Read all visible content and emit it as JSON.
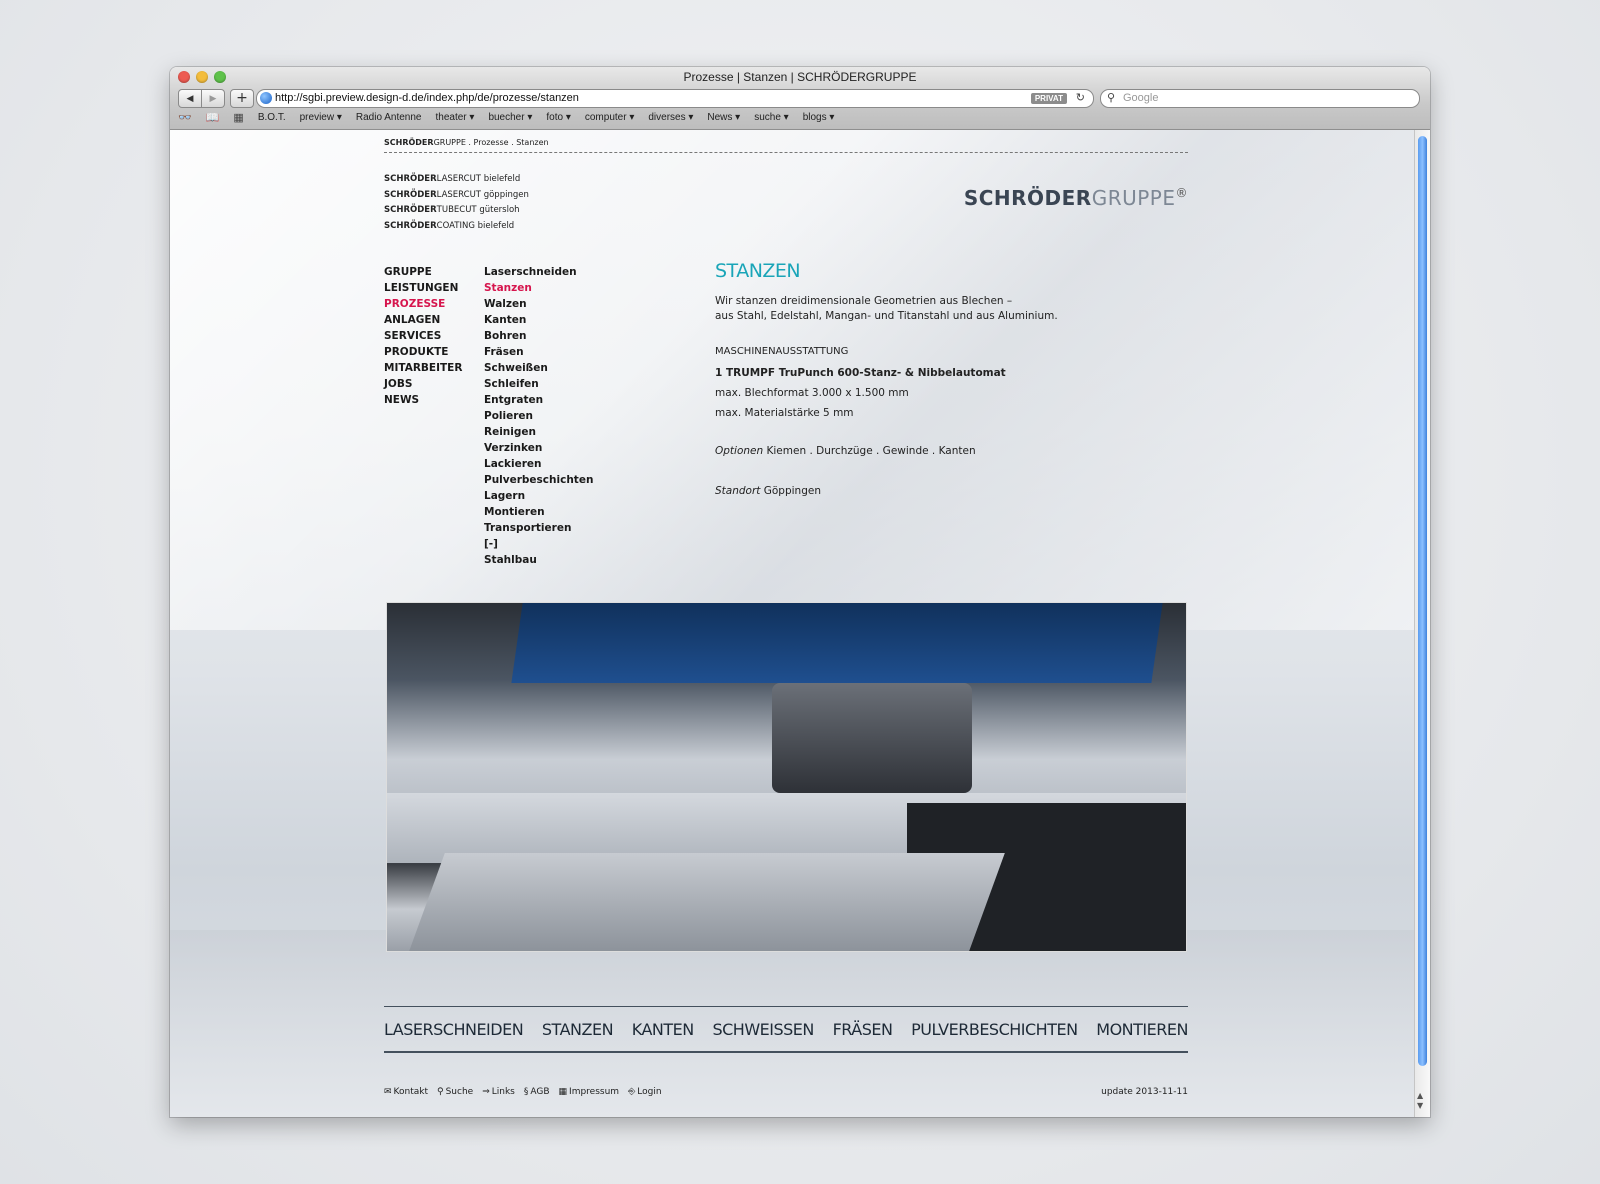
{
  "window": {
    "title": "Prozesse | Stanzen | SCHRÖDERGRUPPE"
  },
  "toolbar": {
    "url": "http://sgbi.preview.design-d.de/index.php/de/prozesse/stanzen",
    "privat_label": "PRIVAT",
    "search_placeholder": "Google",
    "bookmarks": [
      "B.O.T.",
      "preview ▾",
      "Radio Antenne",
      "theater ▾",
      "buecher ▾",
      "foto ▾",
      "computer ▾",
      "diverses ▾",
      "News ▾",
      "suche ▾",
      "blogs ▾"
    ]
  },
  "page": {
    "breadcrumb": {
      "brand_bold": "SCHRÖDER",
      "brand_rest": "GRUPPE",
      "path": " . Prozesse . Stanzen"
    },
    "sites": [
      {
        "bold": "SCHRÖDER",
        "sub": "LASERCUT",
        "city": " bielefeld"
      },
      {
        "bold": "SCHRÖDER",
        "sub": "LASERCUT",
        "city": " göppingen"
      },
      {
        "bold": "SCHRÖDER",
        "sub": "TUBECUT",
        "city": " gütersloh"
      },
      {
        "bold": "SCHRÖDER",
        "sub": "COATING",
        "city": " bielefeld"
      }
    ],
    "logo": {
      "part1": "SCHRÖDER",
      "part2": "GRUPPE",
      "reg": "®"
    },
    "nav_main": [
      "GRUPPE",
      "LEISTUNGEN",
      "PROZESSE",
      "ANLAGEN",
      "SERVICES",
      "PRODUKTE",
      "MITARBEITER",
      "JOBS",
      "NEWS"
    ],
    "nav_main_active": "PROZESSE",
    "nav_sub": [
      "Laserschneiden",
      "Stanzen",
      "Walzen",
      "Kanten",
      "Bohren",
      "Fräsen",
      "Schweißen",
      "Schleifen",
      "Entgraten",
      "Polieren",
      "Reinigen",
      "Verzinken",
      "Lackieren",
      "Pulverbeschichten",
      "Lagern",
      "Montieren",
      "Transportieren",
      "[-]",
      "Stahlbau"
    ],
    "nav_sub_active": "Stanzen",
    "main": {
      "heading": "STANZEN",
      "intro_line1": "Wir stanzen dreidimensionale Geometrien aus Blechen –",
      "intro_line2": "aus Stahl, Edelstahl, Mangan- und Titanstahl und aus Aluminium.",
      "equip_heading": "MASCHINENAUSSTATTUNG",
      "equip_machine": "1 TRUMPF TruPunch 600-Stanz- & Nibbelautomat",
      "equip_format": "max. Blechformat 3.000 x 1.500 mm",
      "equip_thickness": "max. Materialstärke 5 mm",
      "options_label": "Optionen",
      "options_value": " Kiemen . Durchzüge . Gewinde . Kanten",
      "location_label": "Standort",
      "location_value": " Göppingen"
    },
    "process_tabs": [
      "LASERSCHNEIDEN",
      "STANZEN",
      "KANTEN",
      "SCHWEISSEN",
      "FRÄSEN",
      "PULVERBESCHICHTEN",
      "MONTIEREN"
    ],
    "footer": {
      "links": [
        {
          "icon": "✉",
          "label": "Kontakt"
        },
        {
          "icon": "⚲",
          "label": "Suche"
        },
        {
          "icon": "⇒",
          "label": "Links"
        },
        {
          "icon": "§",
          "label": "AGB"
        },
        {
          "icon": "▦",
          "label": "Impressum"
        },
        {
          "icon": "⎆",
          "label": "Login"
        }
      ],
      "updated": "update 2013-11-11"
    }
  },
  "colors": {
    "accent_teal": "#1aa5b8",
    "active_red": "#d6154d",
    "logo_dark": "#3a4553",
    "logo_light": "#7d8794"
  }
}
